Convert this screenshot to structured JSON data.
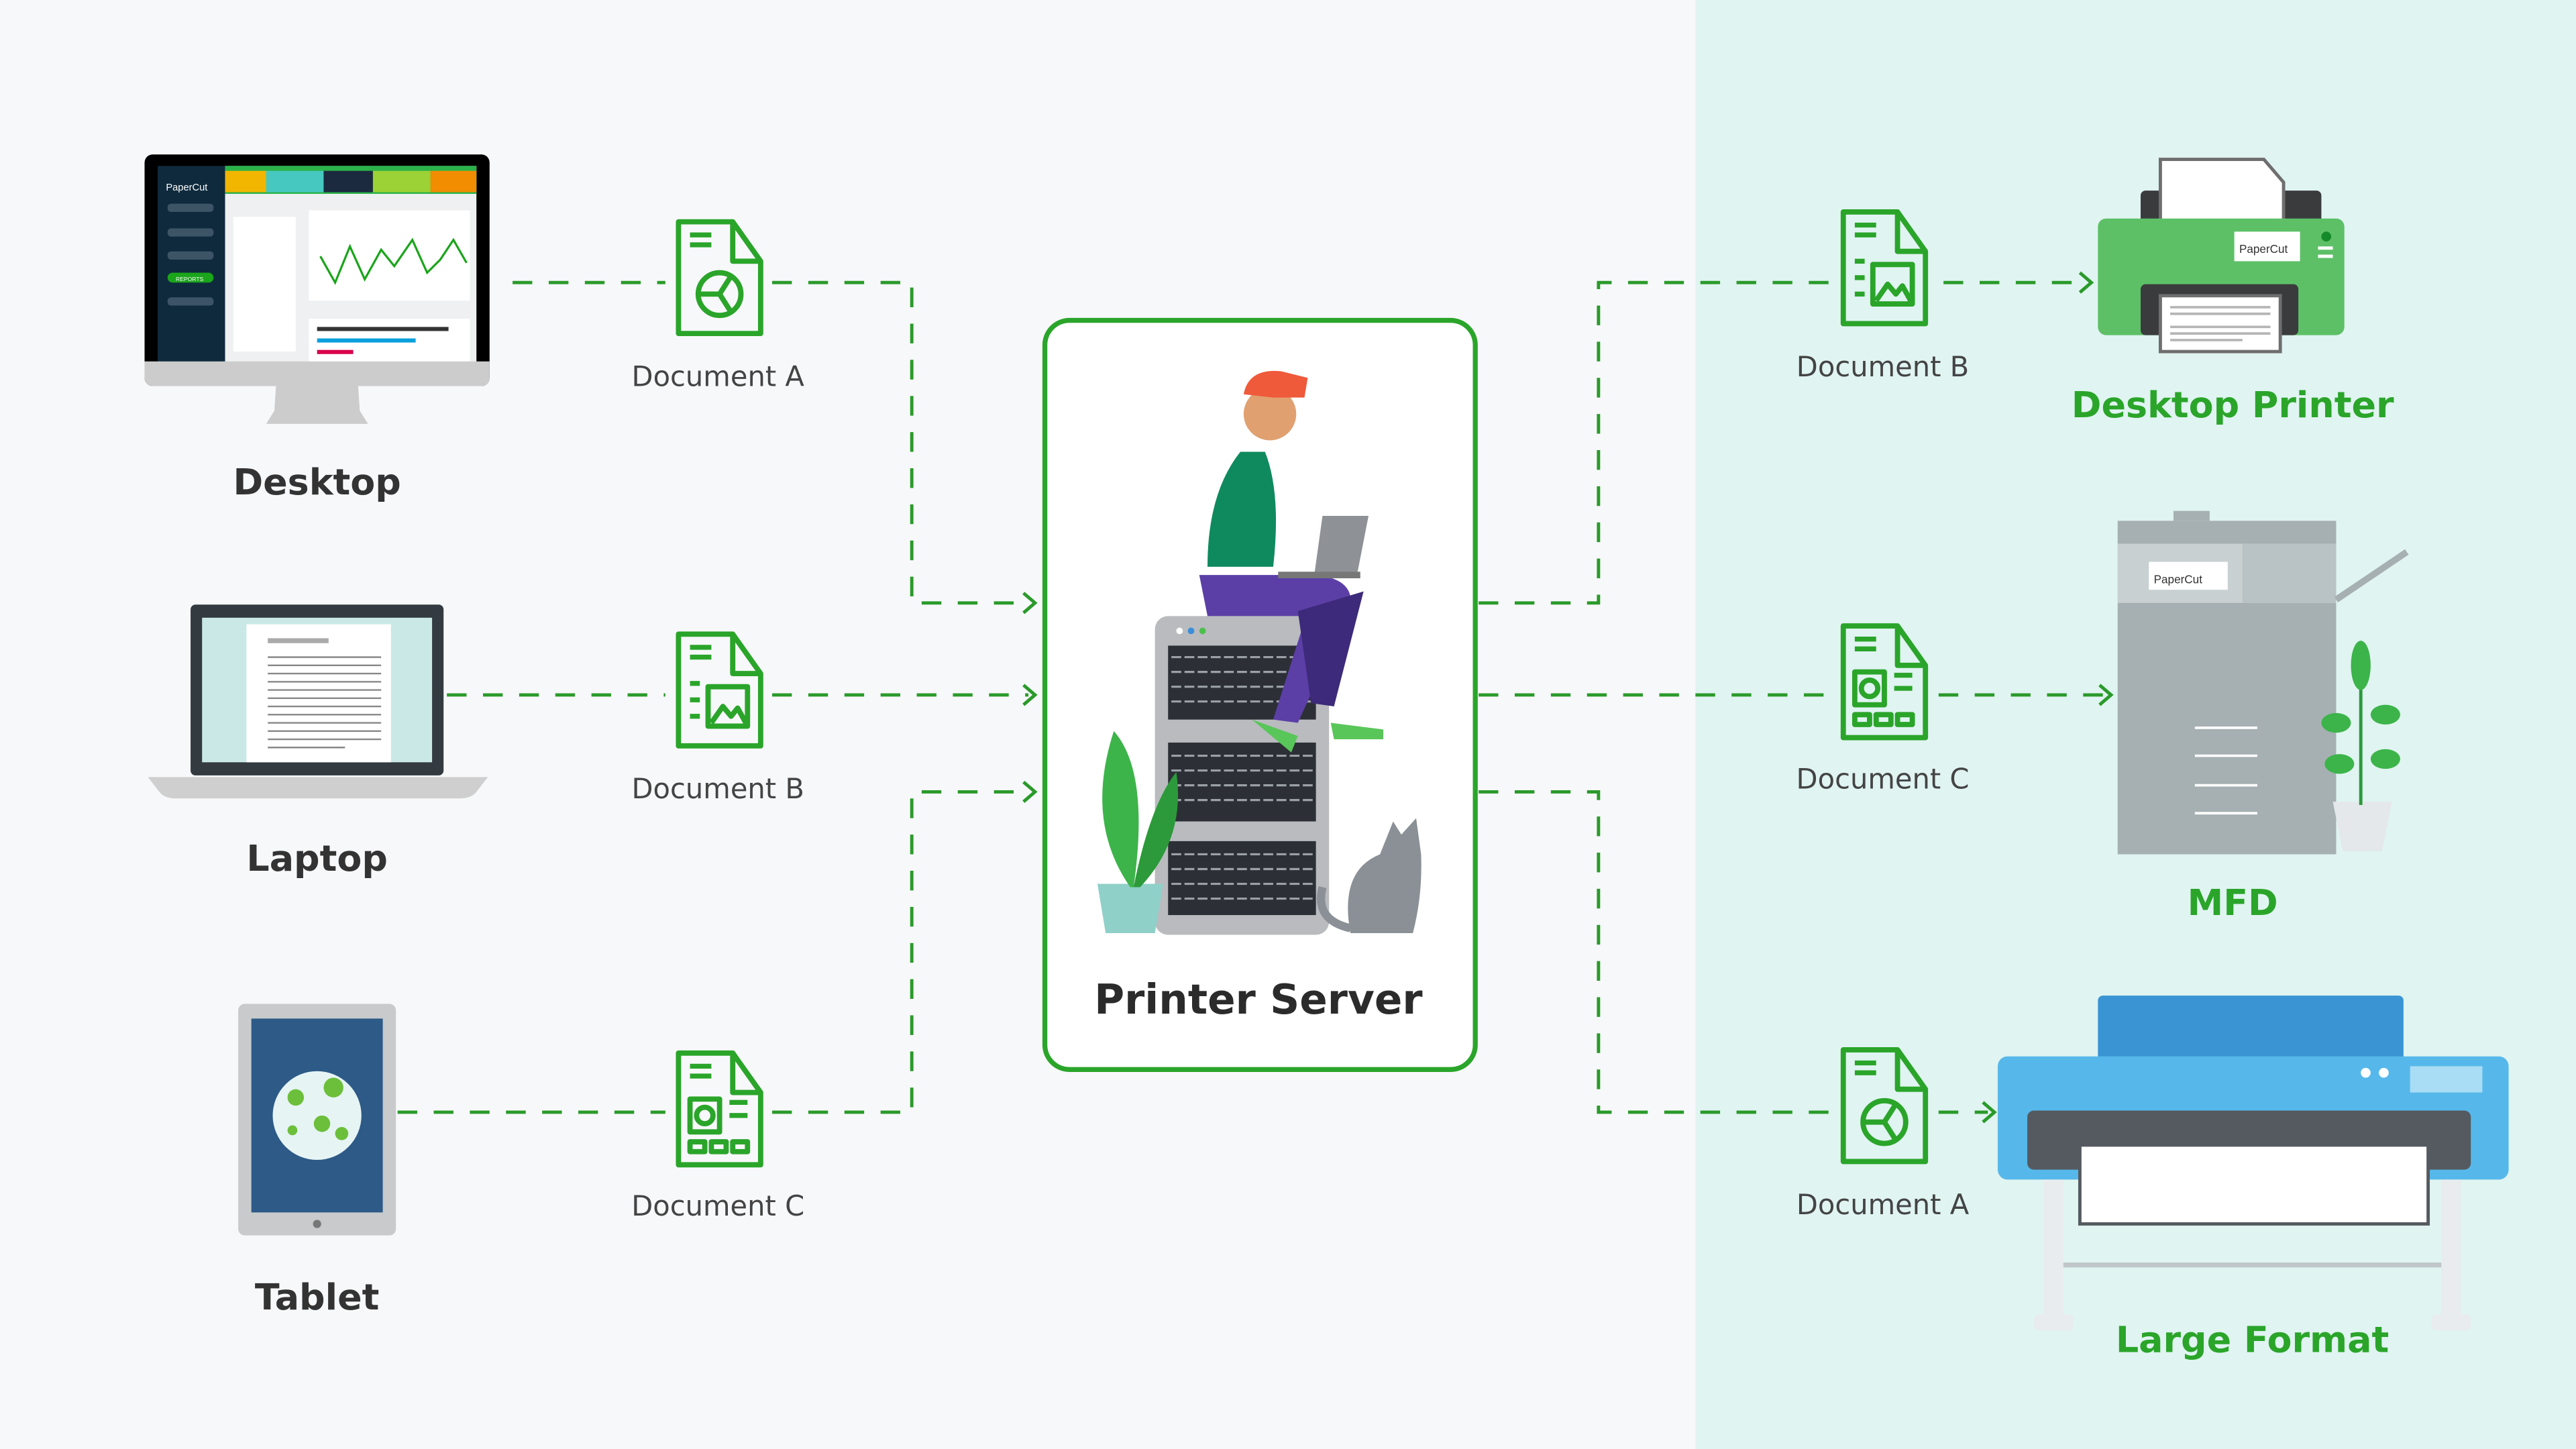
{
  "sources": [
    {
      "label": "Desktop",
      "document": "Document A",
      "screen_brand": "PaperCut",
      "screen_menu_item": "REPORTS"
    },
    {
      "label": "Laptop",
      "document": "Document B"
    },
    {
      "label": "Tablet",
      "document": "Document C"
    }
  ],
  "server": {
    "label": "Printer Server"
  },
  "destinations": [
    {
      "label": "Desktop Printer",
      "document": "Document B",
      "brand": "PaperCut"
    },
    {
      "label": "MFD",
      "document": "Document C",
      "brand": "PaperCut"
    },
    {
      "label": "Large Format",
      "document": "Document A"
    }
  ],
  "colors": {
    "accent": "#2aa52a",
    "background": "#f7f8fa",
    "output_panel": "#e0f4f1",
    "line": "#2a9a2a"
  },
  "icons": {
    "document_a": "document-pie-chart-icon",
    "document_b": "document-image-icon",
    "document_c": "document-copier-icon"
  }
}
